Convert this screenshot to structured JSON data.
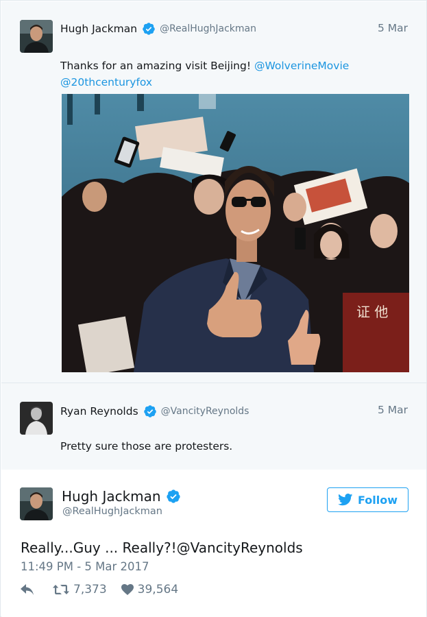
{
  "colors": {
    "link": "#1b95e0",
    "brand": "#1da1f2",
    "muted": "#657786",
    "context_bg": "#f5f8fa"
  },
  "tweet1": {
    "name": "Hugh Jackman",
    "handle": "@RealHughJackman",
    "date": "5 Mar",
    "text_before": "Thanks for an amazing visit Beijing! ",
    "mention_1": "@WolverineMovie",
    "mention_2": "@20thcenturyfox"
  },
  "tweet2": {
    "name": "Ryan Reynolds",
    "handle": "@VancityReynolds",
    "date": "5 Mar",
    "text": "Pretty sure those are protesters."
  },
  "main": {
    "name": "Hugh Jackman",
    "handle": "@RealHughJackman",
    "follow_label": "Follow",
    "text_before": "Really...Guy ... Really?!",
    "mention": "@VancityReynolds",
    "timestamp": "11:49 PM - 5 Mar 2017",
    "retweets": "7,373",
    "likes": "39,564"
  },
  "icons": {
    "verified": "verified-badge-icon",
    "bird": "twitter-bird-icon",
    "reply": "reply-icon",
    "retweet": "retweet-icon",
    "like": "heart-icon"
  }
}
